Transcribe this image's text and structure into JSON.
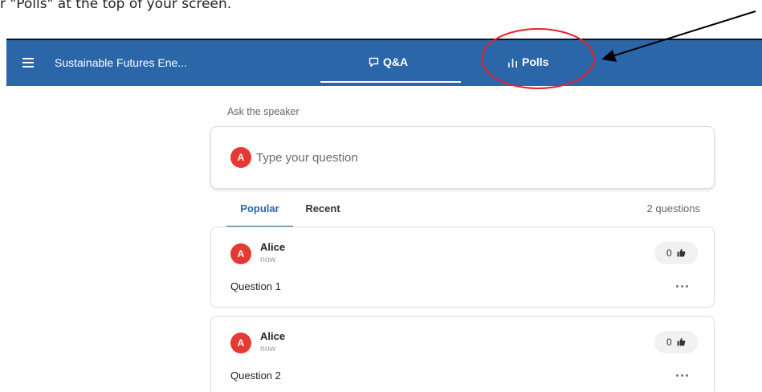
{
  "instruction": {
    "text": "r \"Polls\" at the top of your screen."
  },
  "header": {
    "event_title": "Sustainable Futures Ene...",
    "tabs": [
      {
        "label": "Q&A",
        "icon": "chat-bubble-icon",
        "active": true
      },
      {
        "label": "Polls",
        "icon": "bar-chart-icon",
        "active": false
      }
    ]
  },
  "ask": {
    "label": "Ask the speaker",
    "avatar_initial": "A",
    "placeholder": "Type your question"
  },
  "sort": {
    "tabs": [
      "Popular",
      "Recent"
    ],
    "active": "Popular",
    "count": "2 questions"
  },
  "questions": [
    {
      "author": "Alice",
      "avatar_initial": "A",
      "time": "now",
      "text": "Question 1",
      "likes": "0"
    },
    {
      "author": "Alice",
      "avatar_initial": "A",
      "time": "now",
      "text": "Question 2",
      "likes": "0"
    }
  ],
  "colors": {
    "header_bg": "#2a66a8",
    "accent": "#2a66a8",
    "avatar": "#e53935",
    "annotation": "#e8202a"
  }
}
